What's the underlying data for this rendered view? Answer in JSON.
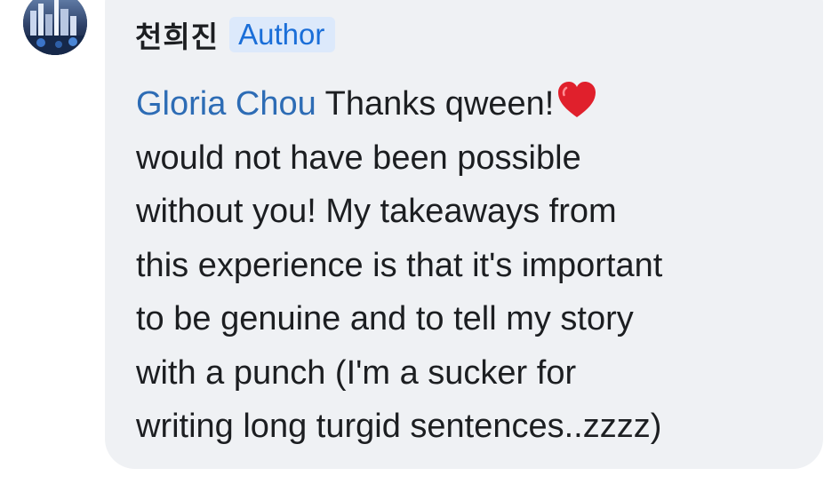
{
  "comment": {
    "author": {
      "name": "천희진",
      "badge": "Author"
    },
    "mention": "Gloria Chou",
    "lines": [
      "Thanks qween!",
      "would not have been possible",
      "without you!  My takeaways from",
      "this experience is that it's important",
      "to be genuine and to tell my story",
      "with a punch (I'm a sucker for",
      "writing long turgid sentences..zzzz)"
    ],
    "emoji": "red-heart-icon"
  },
  "colors": {
    "bubble": "#eff1f4",
    "mention": "#2d6cb5",
    "badge_bg": "#dce9fb",
    "badge_text": "#1a6ed8",
    "text": "#1c1e21",
    "heart": "#e0202c"
  }
}
